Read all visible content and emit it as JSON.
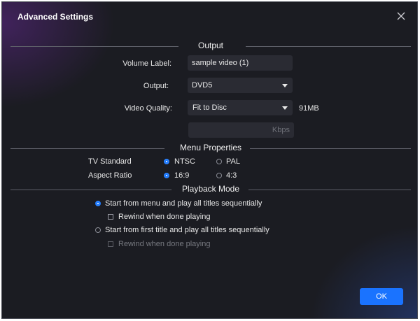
{
  "window": {
    "title": "Advanced Settings",
    "close_icon": "close-icon"
  },
  "output_section": {
    "heading": "Output",
    "volume_label": {
      "label": "Volume Label:",
      "value": "sample video (1)"
    },
    "output": {
      "label": "Output:",
      "value": "DVD5"
    },
    "video_quality": {
      "label": "Video Quality:",
      "value": "Fit to Disc",
      "size": "91MB"
    },
    "bitrate": {
      "value": "",
      "unit": "Kbps"
    }
  },
  "menu_section": {
    "heading": "Menu Properties",
    "tv_standard": {
      "label": "TV Standard",
      "options": [
        "NTSC",
        "PAL"
      ],
      "selected": "NTSC"
    },
    "aspect_ratio": {
      "label": "Aspect Ratio",
      "options": [
        "16:9",
        "4:3"
      ],
      "selected": "16:9"
    }
  },
  "playback_section": {
    "heading": "Playback Mode",
    "options": [
      {
        "label": "Start from menu and play all titles sequentially",
        "selected": true,
        "rewind": {
          "label": "Rewind when done playing",
          "checked": false,
          "enabled": true
        }
      },
      {
        "label": "Start from first title and play all titles sequentially",
        "selected": false,
        "rewind": {
          "label": "Rewind when done playing",
          "checked": false,
          "enabled": false
        }
      }
    ]
  },
  "footer": {
    "ok_label": "OK"
  },
  "colors": {
    "background": "#1b1c22",
    "accent": "#1a73ff",
    "field": "#2a2b33"
  }
}
